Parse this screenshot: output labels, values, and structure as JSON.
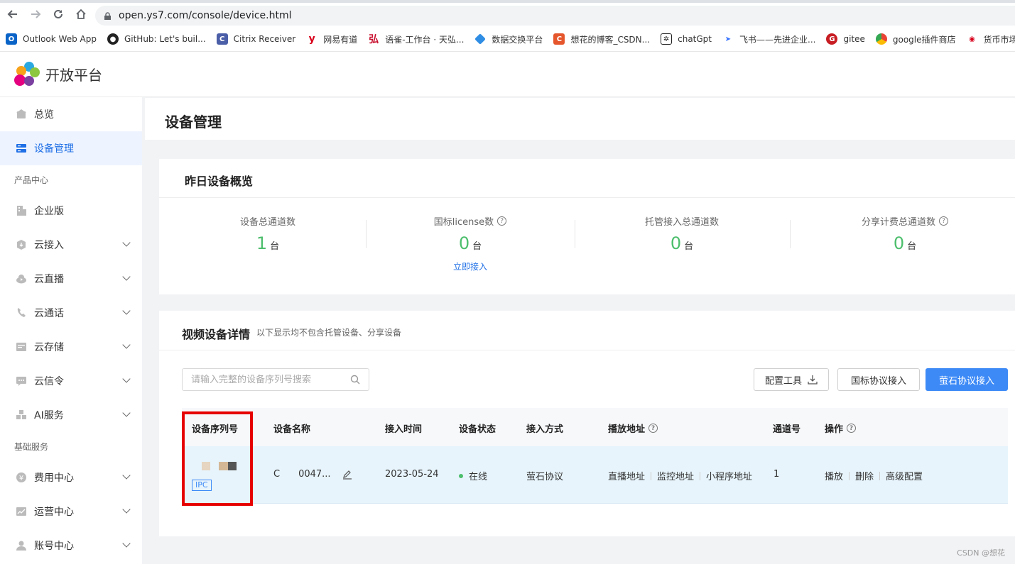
{
  "browser": {
    "url": "open.ys7.com/console/device.html",
    "bookmarks": [
      {
        "label": "Outlook Web App",
        "color": "#0a64c8"
      },
      {
        "label": "GitHub: Let's buil...",
        "color": "#222222"
      },
      {
        "label": "Citrix Receiver",
        "color": "#4b5ea8"
      },
      {
        "label": "网易有道",
        "color": "#d8001b"
      },
      {
        "label": "语雀-工作台 · 天弘...",
        "color": "#c8102e"
      },
      {
        "label": "数据交换平台",
        "color": "#2f8de4"
      },
      {
        "label": "想花的博客_CSDN...",
        "color": "#e5562d"
      },
      {
        "label": "chatGpt",
        "color": "#222222"
      },
      {
        "label": "飞书——先进企业...",
        "color": "#3370ff"
      },
      {
        "label": "gitee",
        "color": "#c71d23"
      },
      {
        "label": "google插件商店",
        "color": "#4285f4"
      },
      {
        "label": "货币市场I",
        "color": "#d8001b"
      }
    ]
  },
  "app": {
    "brand": "开放平台"
  },
  "sidebar": {
    "items": [
      {
        "label": "总览",
        "icon": "home-icon"
      },
      {
        "label": "设备管理",
        "icon": "device-icon"
      }
    ],
    "group_product": "产品中心",
    "product_items": [
      {
        "label": "企业版",
        "icon": "building-icon"
      },
      {
        "label": "云接入",
        "icon": "cloud-in-icon"
      },
      {
        "label": "云直播",
        "icon": "cloud-live-icon"
      },
      {
        "label": "云通话",
        "icon": "phone-icon"
      },
      {
        "label": "云存储",
        "icon": "storage-icon"
      },
      {
        "label": "云信令",
        "icon": "message-icon"
      },
      {
        "label": "AI服务",
        "icon": "ai-icon"
      }
    ],
    "group_basic": "基础服务",
    "basic_items": [
      {
        "label": "费用中心",
        "icon": "yen-icon"
      },
      {
        "label": "运营中心",
        "icon": "chart-icon"
      },
      {
        "label": "账号中心",
        "icon": "user-icon"
      }
    ]
  },
  "page": {
    "title": "设备管理"
  },
  "overview": {
    "title": "昨日设备概览",
    "stats": [
      {
        "label": "设备总通道数",
        "value": "1",
        "unit": "台"
      },
      {
        "label": "国标license数",
        "value": "0",
        "unit": "台",
        "link": "立即接入"
      },
      {
        "label": "托管接入总通道数",
        "value": "0",
        "unit": "台"
      },
      {
        "label": "分享计费总通道数",
        "value": "0",
        "unit": "台"
      }
    ]
  },
  "detail": {
    "title": "视频设备详情",
    "subtitle": "以下显示均不包含托管设备、分享设备",
    "search_placeholder": "请输入完整的设备序列号搜索",
    "buttons": {
      "config_tool": "配置工具",
      "gb_access": "国标协议接入",
      "ys_access": "萤石协议接入"
    },
    "columns": [
      "设备序列号",
      "设备名称",
      "接入时间",
      "设备状态",
      "接入方式",
      "播放地址",
      "通道号",
      "操作"
    ],
    "row": {
      "badge": "IPC",
      "name": "C  0047...",
      "time": "2023-05-24",
      "status": "在线",
      "method": "萤石协议",
      "play_links": [
        "直播地址",
        "监控地址",
        "小程序地址"
      ],
      "channel": "1",
      "ops": [
        "播放",
        "删除",
        "高级配置"
      ]
    }
  },
  "watermark": "CSDN @想花"
}
